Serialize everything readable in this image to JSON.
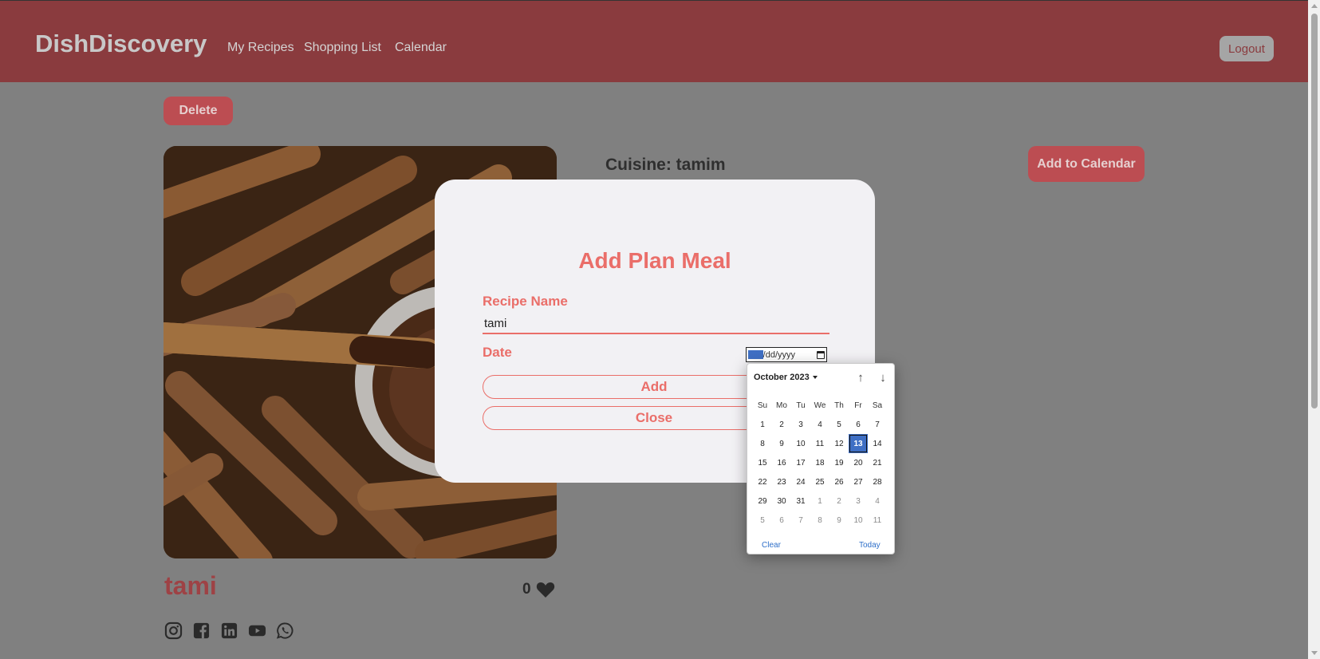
{
  "header": {
    "brand": "DishDiscovery",
    "nav": [
      "My Recipes",
      "Shopping List",
      "Calendar"
    ],
    "logout_label": "Logout"
  },
  "page": {
    "delete_label": "Delete",
    "cuisine": "Cuisine: tamim",
    "add_to_calendar_label": "Add to Calendar",
    "recipe_title": "tami",
    "likes": "0",
    "social_icons": [
      "instagram-icon",
      "facebook-icon",
      "linkedin-icon",
      "youtube-icon",
      "whatsapp-icon"
    ]
  },
  "modal": {
    "title": "Add Plan Meal",
    "recipe_label": "Recipe Name",
    "recipe_value": "tami",
    "date_label": "Date",
    "date_placeholder_mm": "mm",
    "date_placeholder_rest": "/dd/yyyy",
    "add_label": "Add",
    "close_label": "Close"
  },
  "date_picker": {
    "month_label": "October 2023",
    "weekdays": [
      "Su",
      "Mo",
      "Tu",
      "We",
      "Th",
      "Fr",
      "Sa"
    ],
    "days": [
      [
        "1",
        "2",
        "3",
        "4",
        "5",
        "6",
        "7"
      ],
      [
        "8",
        "9",
        "10",
        "11",
        "12",
        "13",
        "14"
      ],
      [
        "15",
        "16",
        "17",
        "18",
        "19",
        "20",
        "21"
      ],
      [
        "22",
        "23",
        "24",
        "25",
        "26",
        "27",
        "28"
      ],
      [
        "29",
        "30",
        "31",
        "1",
        "2",
        "3",
        "4"
      ],
      [
        "5",
        "6",
        "7",
        "8",
        "9",
        "10",
        "11"
      ]
    ],
    "selected_day": "13",
    "clear_label": "Clear",
    "today_label": "Today"
  },
  "colors": {
    "header_bg": "#8a3b3e",
    "accent": "#ea6e69",
    "overlay_bg": "#808080",
    "picker_selected": "#3f6fc4"
  }
}
